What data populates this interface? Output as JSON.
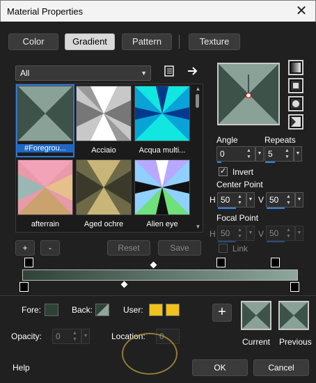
{
  "window": {
    "title": "Material Properties",
    "close_glyph": "✕"
  },
  "tabs": [
    {
      "label": "Color"
    },
    {
      "label": "Gradient"
    },
    {
      "label": "Pattern"
    },
    {
      "label": "Texture"
    }
  ],
  "category": {
    "selected": "All"
  },
  "gradients": [
    {
      "name": "#Foregrou...",
      "selected": true
    },
    {
      "name": "Acciaio"
    },
    {
      "name": "Acqua multi..."
    },
    {
      "name": "afterrain"
    },
    {
      "name": "Aged ochre"
    },
    {
      "name": "Alien eye"
    }
  ],
  "list_controls": {
    "add": "+",
    "remove": "-",
    "reset": "Reset",
    "save": "Save"
  },
  "angle": {
    "label": "Angle",
    "value": "0"
  },
  "repeats": {
    "label": "Repeats",
    "value": "5"
  },
  "invert": {
    "label": "Invert",
    "checked": true
  },
  "center_point": {
    "label": "Center Point",
    "h_label": "H",
    "h_value": "50",
    "v_label": "V",
    "v_value": "50"
  },
  "focal_point": {
    "label": "Focal Point",
    "h_label": "H",
    "h_value": "50",
    "v_label": "V",
    "v_value": "50"
  },
  "link": {
    "label": "Link",
    "checked": false
  },
  "bottom": {
    "fore_label": "Fore:",
    "back_label": "Back:",
    "user_label": "User:",
    "opacity_label": "Opacity:",
    "opacity_value": "0",
    "location_label": "Location:",
    "location_value": "0",
    "add_glyph": "+",
    "current_label": "Current",
    "previous_label": "Previous"
  },
  "footer": {
    "help": "Help",
    "ok": "OK",
    "cancel": "Cancel"
  },
  "colors": {
    "accent": "#2f86e0",
    "gradient_dark": "#2f4238",
    "gradient_light": "#8fa69c",
    "user_yellow": "#f0c21c"
  }
}
